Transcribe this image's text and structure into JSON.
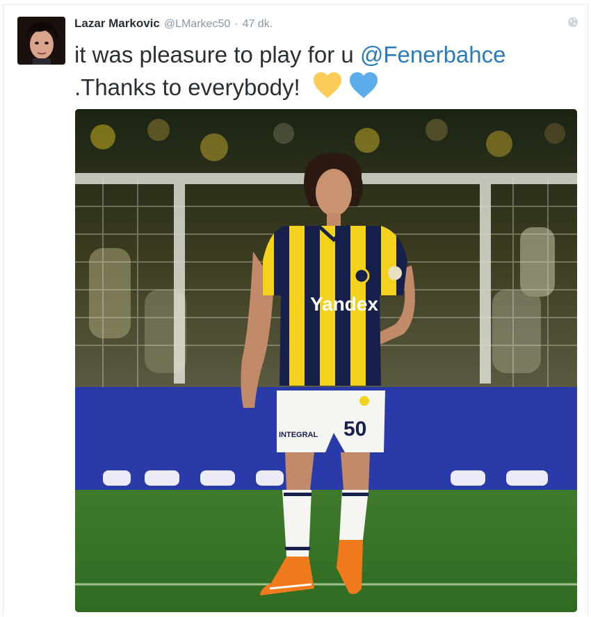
{
  "tweet": {
    "display_name": "Lazar Markovic",
    "screen_name": "@LMarkec50",
    "separator": "·",
    "timestamp": "47 dk.",
    "text_before": "it was pleasure to play for u ",
    "mention": "@Fenerbahce",
    "text_after": " .Thanks to everybody! ",
    "emoji": [
      "yellow-heart",
      "blue-heart"
    ]
  },
  "photo": {
    "sponsor_text": "Yandex",
    "shirt_number": "50",
    "shorts_brand": "INTEGRAL"
  },
  "colors": {
    "mention": "#2b7bb9",
    "yellow_heart": "#fdcb58",
    "blue_heart": "#5dadec"
  },
  "icons": [
    "globe-icon"
  ]
}
